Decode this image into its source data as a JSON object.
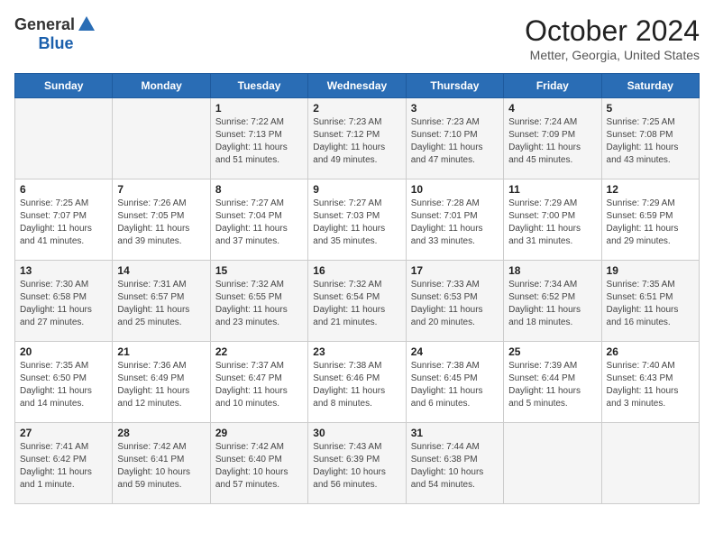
{
  "logo": {
    "general": "General",
    "blue": "Blue"
  },
  "header": {
    "month": "October 2024",
    "location": "Metter, Georgia, United States"
  },
  "days_of_week": [
    "Sunday",
    "Monday",
    "Tuesday",
    "Wednesday",
    "Thursday",
    "Friday",
    "Saturday"
  ],
  "weeks": [
    [
      {
        "day": "",
        "info": ""
      },
      {
        "day": "",
        "info": ""
      },
      {
        "day": "1",
        "info": "Sunrise: 7:22 AM\nSunset: 7:13 PM\nDaylight: 11 hours and 51 minutes."
      },
      {
        "day": "2",
        "info": "Sunrise: 7:23 AM\nSunset: 7:12 PM\nDaylight: 11 hours and 49 minutes."
      },
      {
        "day": "3",
        "info": "Sunrise: 7:23 AM\nSunset: 7:10 PM\nDaylight: 11 hours and 47 minutes."
      },
      {
        "day": "4",
        "info": "Sunrise: 7:24 AM\nSunset: 7:09 PM\nDaylight: 11 hours and 45 minutes."
      },
      {
        "day": "5",
        "info": "Sunrise: 7:25 AM\nSunset: 7:08 PM\nDaylight: 11 hours and 43 minutes."
      }
    ],
    [
      {
        "day": "6",
        "info": "Sunrise: 7:25 AM\nSunset: 7:07 PM\nDaylight: 11 hours and 41 minutes."
      },
      {
        "day": "7",
        "info": "Sunrise: 7:26 AM\nSunset: 7:05 PM\nDaylight: 11 hours and 39 minutes."
      },
      {
        "day": "8",
        "info": "Sunrise: 7:27 AM\nSunset: 7:04 PM\nDaylight: 11 hours and 37 minutes."
      },
      {
        "day": "9",
        "info": "Sunrise: 7:27 AM\nSunset: 7:03 PM\nDaylight: 11 hours and 35 minutes."
      },
      {
        "day": "10",
        "info": "Sunrise: 7:28 AM\nSunset: 7:01 PM\nDaylight: 11 hours and 33 minutes."
      },
      {
        "day": "11",
        "info": "Sunrise: 7:29 AM\nSunset: 7:00 PM\nDaylight: 11 hours and 31 minutes."
      },
      {
        "day": "12",
        "info": "Sunrise: 7:29 AM\nSunset: 6:59 PM\nDaylight: 11 hours and 29 minutes."
      }
    ],
    [
      {
        "day": "13",
        "info": "Sunrise: 7:30 AM\nSunset: 6:58 PM\nDaylight: 11 hours and 27 minutes."
      },
      {
        "day": "14",
        "info": "Sunrise: 7:31 AM\nSunset: 6:57 PM\nDaylight: 11 hours and 25 minutes."
      },
      {
        "day": "15",
        "info": "Sunrise: 7:32 AM\nSunset: 6:55 PM\nDaylight: 11 hours and 23 minutes."
      },
      {
        "day": "16",
        "info": "Sunrise: 7:32 AM\nSunset: 6:54 PM\nDaylight: 11 hours and 21 minutes."
      },
      {
        "day": "17",
        "info": "Sunrise: 7:33 AM\nSunset: 6:53 PM\nDaylight: 11 hours and 20 minutes."
      },
      {
        "day": "18",
        "info": "Sunrise: 7:34 AM\nSunset: 6:52 PM\nDaylight: 11 hours and 18 minutes."
      },
      {
        "day": "19",
        "info": "Sunrise: 7:35 AM\nSunset: 6:51 PM\nDaylight: 11 hours and 16 minutes."
      }
    ],
    [
      {
        "day": "20",
        "info": "Sunrise: 7:35 AM\nSunset: 6:50 PM\nDaylight: 11 hours and 14 minutes."
      },
      {
        "day": "21",
        "info": "Sunrise: 7:36 AM\nSunset: 6:49 PM\nDaylight: 11 hours and 12 minutes."
      },
      {
        "day": "22",
        "info": "Sunrise: 7:37 AM\nSunset: 6:47 PM\nDaylight: 11 hours and 10 minutes."
      },
      {
        "day": "23",
        "info": "Sunrise: 7:38 AM\nSunset: 6:46 PM\nDaylight: 11 hours and 8 minutes."
      },
      {
        "day": "24",
        "info": "Sunrise: 7:38 AM\nSunset: 6:45 PM\nDaylight: 11 hours and 6 minutes."
      },
      {
        "day": "25",
        "info": "Sunrise: 7:39 AM\nSunset: 6:44 PM\nDaylight: 11 hours and 5 minutes."
      },
      {
        "day": "26",
        "info": "Sunrise: 7:40 AM\nSunset: 6:43 PM\nDaylight: 11 hours and 3 minutes."
      }
    ],
    [
      {
        "day": "27",
        "info": "Sunrise: 7:41 AM\nSunset: 6:42 PM\nDaylight: 11 hours and 1 minute."
      },
      {
        "day": "28",
        "info": "Sunrise: 7:42 AM\nSunset: 6:41 PM\nDaylight: 10 hours and 59 minutes."
      },
      {
        "day": "29",
        "info": "Sunrise: 7:42 AM\nSunset: 6:40 PM\nDaylight: 10 hours and 57 minutes."
      },
      {
        "day": "30",
        "info": "Sunrise: 7:43 AM\nSunset: 6:39 PM\nDaylight: 10 hours and 56 minutes."
      },
      {
        "day": "31",
        "info": "Sunrise: 7:44 AM\nSunset: 6:38 PM\nDaylight: 10 hours and 54 minutes."
      },
      {
        "day": "",
        "info": ""
      },
      {
        "day": "",
        "info": ""
      }
    ]
  ]
}
